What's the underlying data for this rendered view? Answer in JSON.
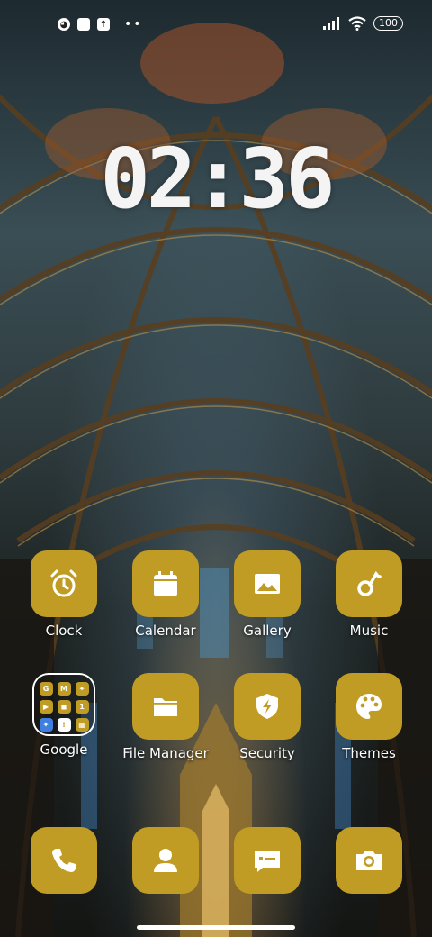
{
  "status_bar": {
    "left_icons": [
      "messenger-icon",
      "square-icon",
      "upload-icon"
    ],
    "dots": "••",
    "right_icons": [
      "signal-icon",
      "wifi-icon"
    ],
    "battery": "100"
  },
  "clock": {
    "time": "02:36"
  },
  "apps": [
    {
      "label": "Clock",
      "icon": "alarm-clock-icon"
    },
    {
      "label": "Calendar",
      "icon": "calendar-icon"
    },
    {
      "label": "Gallery",
      "icon": "image-icon"
    },
    {
      "label": "Music",
      "icon": "music-note-icon"
    },
    {
      "label": "Google",
      "icon": "folder-icon"
    },
    {
      "label": "File Manager",
      "icon": "folder-icon"
    },
    {
      "label": "Security",
      "icon": "shield-icon"
    },
    {
      "label": "Themes",
      "icon": "palette-icon"
    }
  ],
  "google_folder": {
    "mini_apps": [
      "G",
      "M",
      "⌖",
      "▶",
      "◼",
      "1",
      "✦",
      "⁞",
      "▦"
    ]
  },
  "dock": [
    {
      "icon": "phone-icon"
    },
    {
      "icon": "contacts-icon"
    },
    {
      "icon": "messages-icon"
    },
    {
      "icon": "camera-icon"
    }
  ]
}
